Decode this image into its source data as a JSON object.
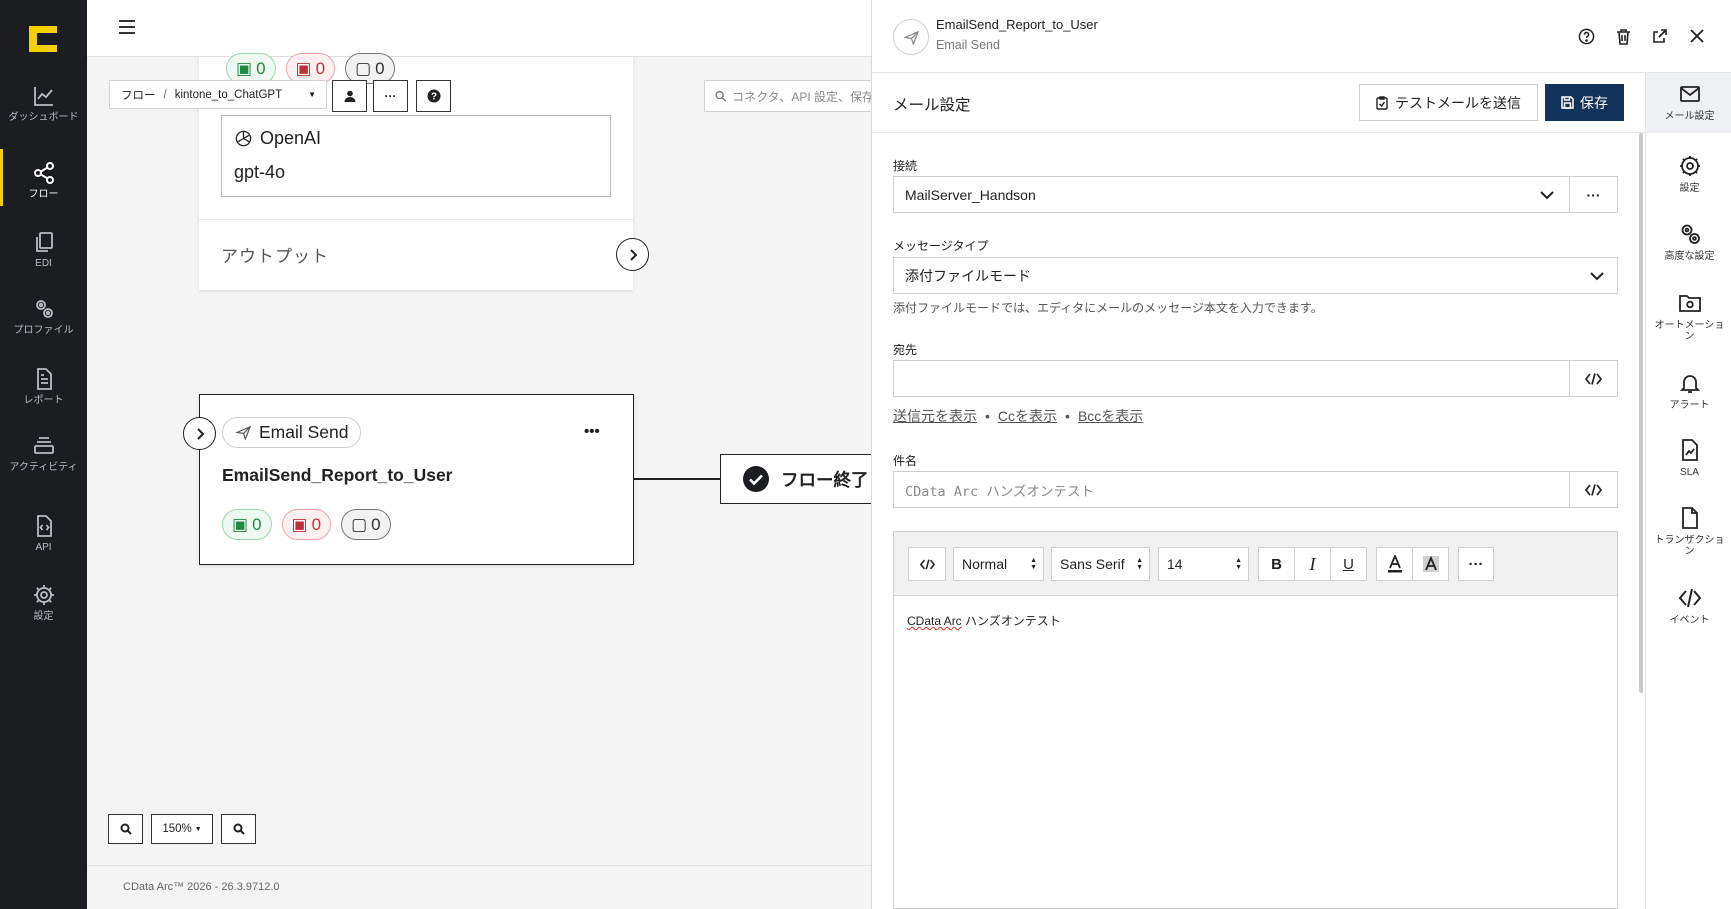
{
  "nav": {
    "items": [
      {
        "label": "ダッシュボード",
        "icon": "chart-line-icon"
      },
      {
        "label": "フロー",
        "icon": "flow-share-icon"
      },
      {
        "label": "EDI",
        "icon": "copy-document-icon"
      },
      {
        "label": "プロファイル",
        "icon": "gears-icon"
      },
      {
        "label": "レポート",
        "icon": "report-document-icon"
      },
      {
        "label": "アクティビティ",
        "icon": "activity-stack-icon"
      },
      {
        "label": "API",
        "icon": "api-document-icon"
      },
      {
        "label": "設定",
        "icon": "gear-icon"
      }
    ],
    "active": "フロー"
  },
  "canvas": {
    "breadcrumb": {
      "root": "フロー",
      "sep": "/",
      "flow": "kintone_to_ChatGPT"
    },
    "search_placeholder": "コネクタ、API 設定、保存",
    "openai_node": {
      "badges": [
        "0",
        "0",
        "0"
      ],
      "provider": "OpenAI",
      "model": "gpt-4o",
      "output_label": "アウトプット"
    },
    "email_node": {
      "type_label": "Email Send",
      "name": "EmailSend_Report_to_User",
      "badges": {
        "success": "0",
        "error": "0",
        "pending": "0"
      },
      "more": "•••"
    },
    "flow_end_label": "フロー終了",
    "zoom": "150%",
    "version": "CData Arc™ 2026 - 26.3.9712.0"
  },
  "panel": {
    "title": "EmailSend_Report_to_User",
    "subtitle": "Email Send",
    "section_title": "メール設定",
    "test_button": "テストメールを送信",
    "save_button": "保存",
    "form": {
      "connection_label": "接続",
      "connection_value": "MailServer_Handson",
      "message_type_label": "メッセージタイプ",
      "message_type_value": "添付ファイルモード",
      "message_type_help": "添付ファイルモードでは、エディタにメールのメッセージ本文を入力できます。",
      "to_label": "宛先",
      "to_value": "",
      "links": {
        "from": "送信元を表示",
        "cc": "Ccを表示",
        "bcc": "Bccを表示",
        "dot": "•"
      },
      "subject_label": "件名",
      "subject_placeholder": "CData Arc ハンズオンテスト",
      "editor": {
        "code": "</>",
        "style": "Normal",
        "font": "Sans Serif",
        "size": "14",
        "bold": "B",
        "italic": "I",
        "underline": "U",
        "more": "···",
        "body_spell": "CData Arc",
        "body_rest": " ハンズオンテスト"
      }
    },
    "tabs": [
      {
        "label": "メール設定",
        "icon": "envelope-icon"
      },
      {
        "label": "設定",
        "icon": "gear-icon"
      },
      {
        "label": "高度な設定",
        "icon": "gears-icon"
      },
      {
        "label": "オートメーション",
        "icon": "folder-gear-icon"
      },
      {
        "label": "アラート",
        "icon": "bell-icon"
      },
      {
        "label": "SLA",
        "icon": "sla-document-icon"
      },
      {
        "label": "トランザクション",
        "icon": "transaction-document-icon"
      },
      {
        "label": "イベント",
        "icon": "code-icon"
      }
    ]
  },
  "colors": {
    "accent": "#f5d000",
    "save": "#13325a",
    "nav_bg": "#1b1d21"
  }
}
